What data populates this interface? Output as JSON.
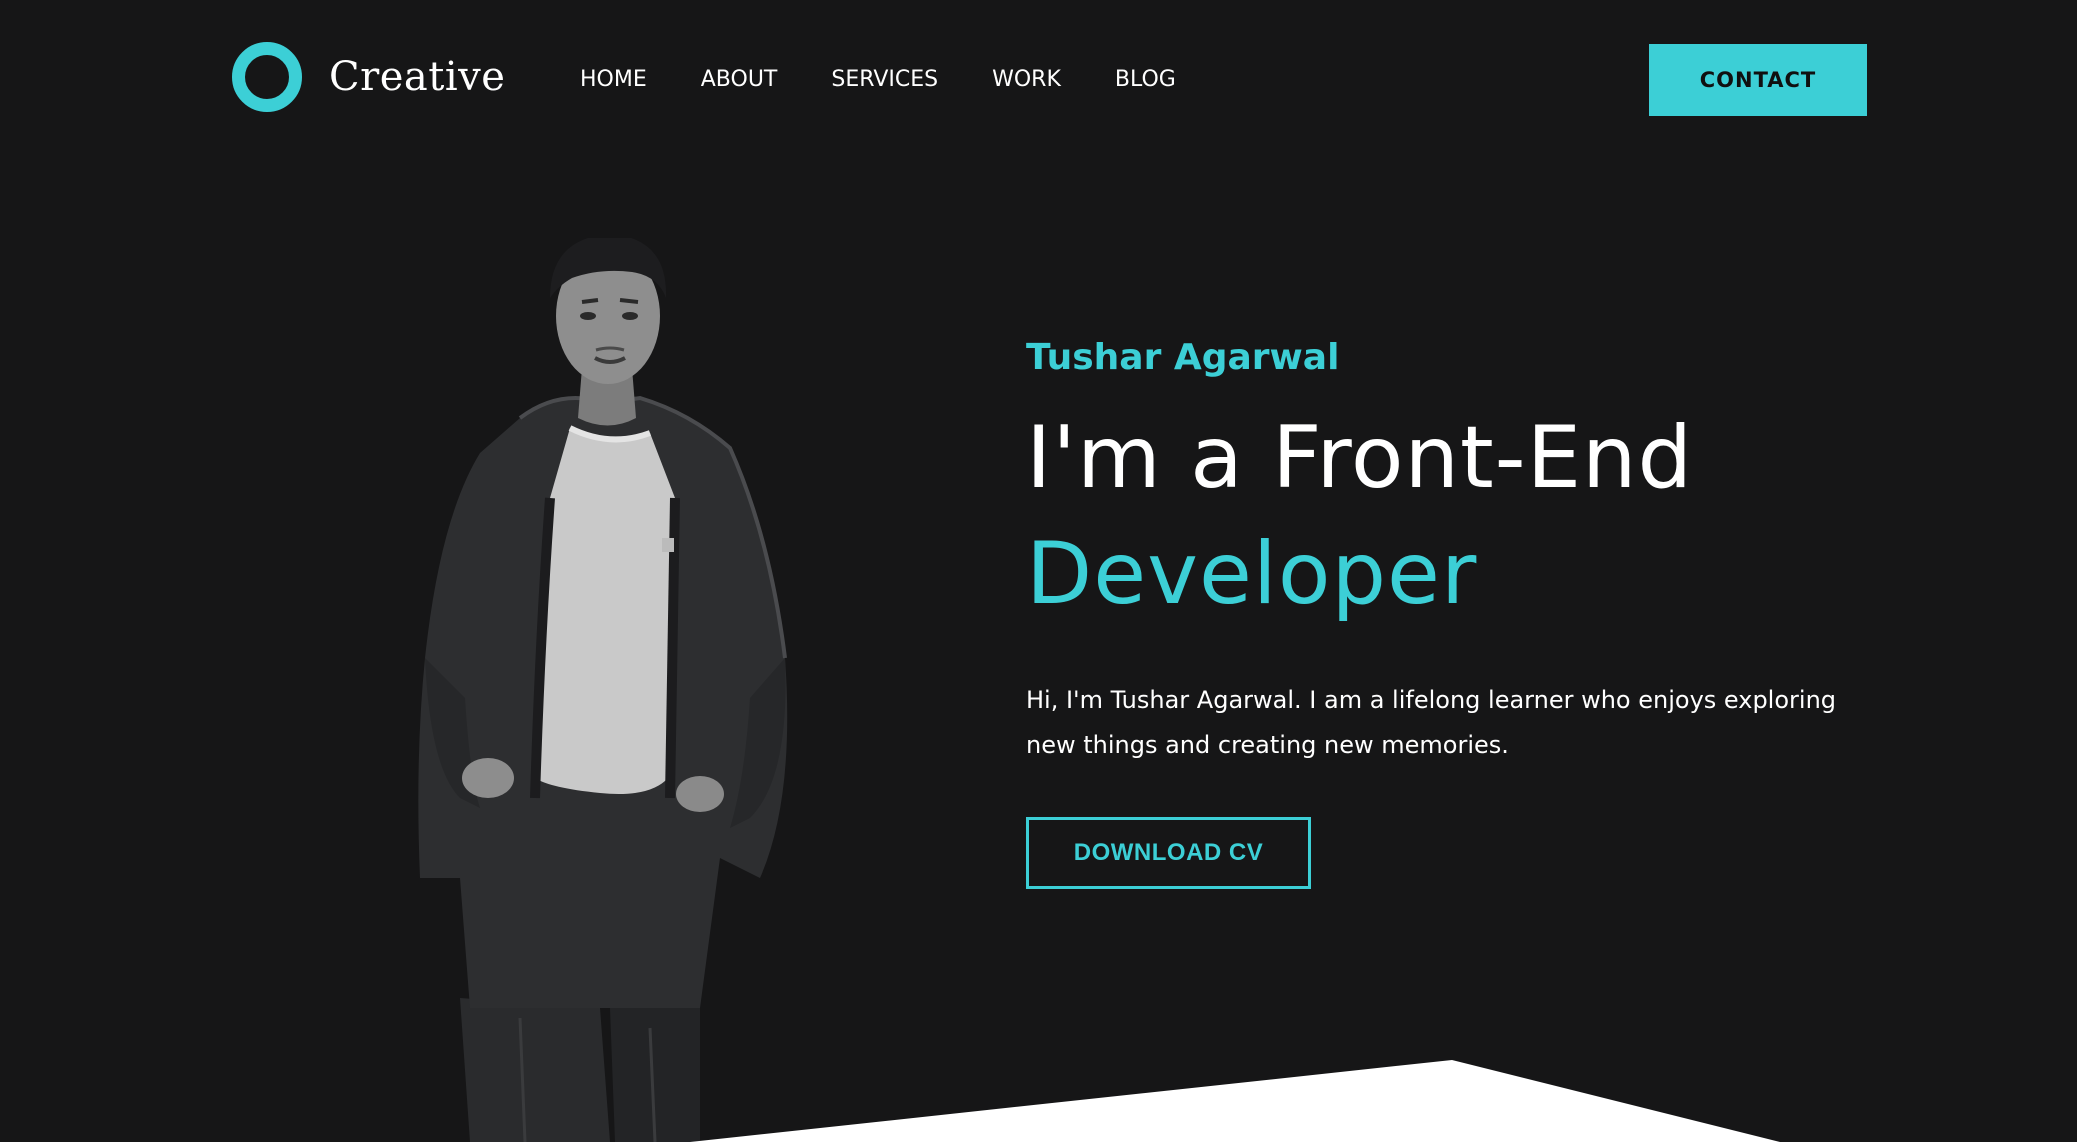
{
  "header": {
    "logo_text": "Creative",
    "nav": [
      "HOME",
      "ABOUT",
      "SERVICES",
      "WORK",
      "BLOG"
    ],
    "contact_label": "CONTACT"
  },
  "hero": {
    "name": "Tushar Agarwal",
    "title_line1": "I'm a Front-End",
    "title_line2": "Developer",
    "description": "Hi, I'm Tushar Agarwal. I am a lifelong learner who enjoys exploring new things and creating new memories.",
    "cv_label": "DOWNLOAD CV"
  },
  "colors": {
    "background": "#161617",
    "accent": "#3ccfd6",
    "text": "#ffffff"
  },
  "icons": {
    "logo": "ring-logo-icon"
  }
}
